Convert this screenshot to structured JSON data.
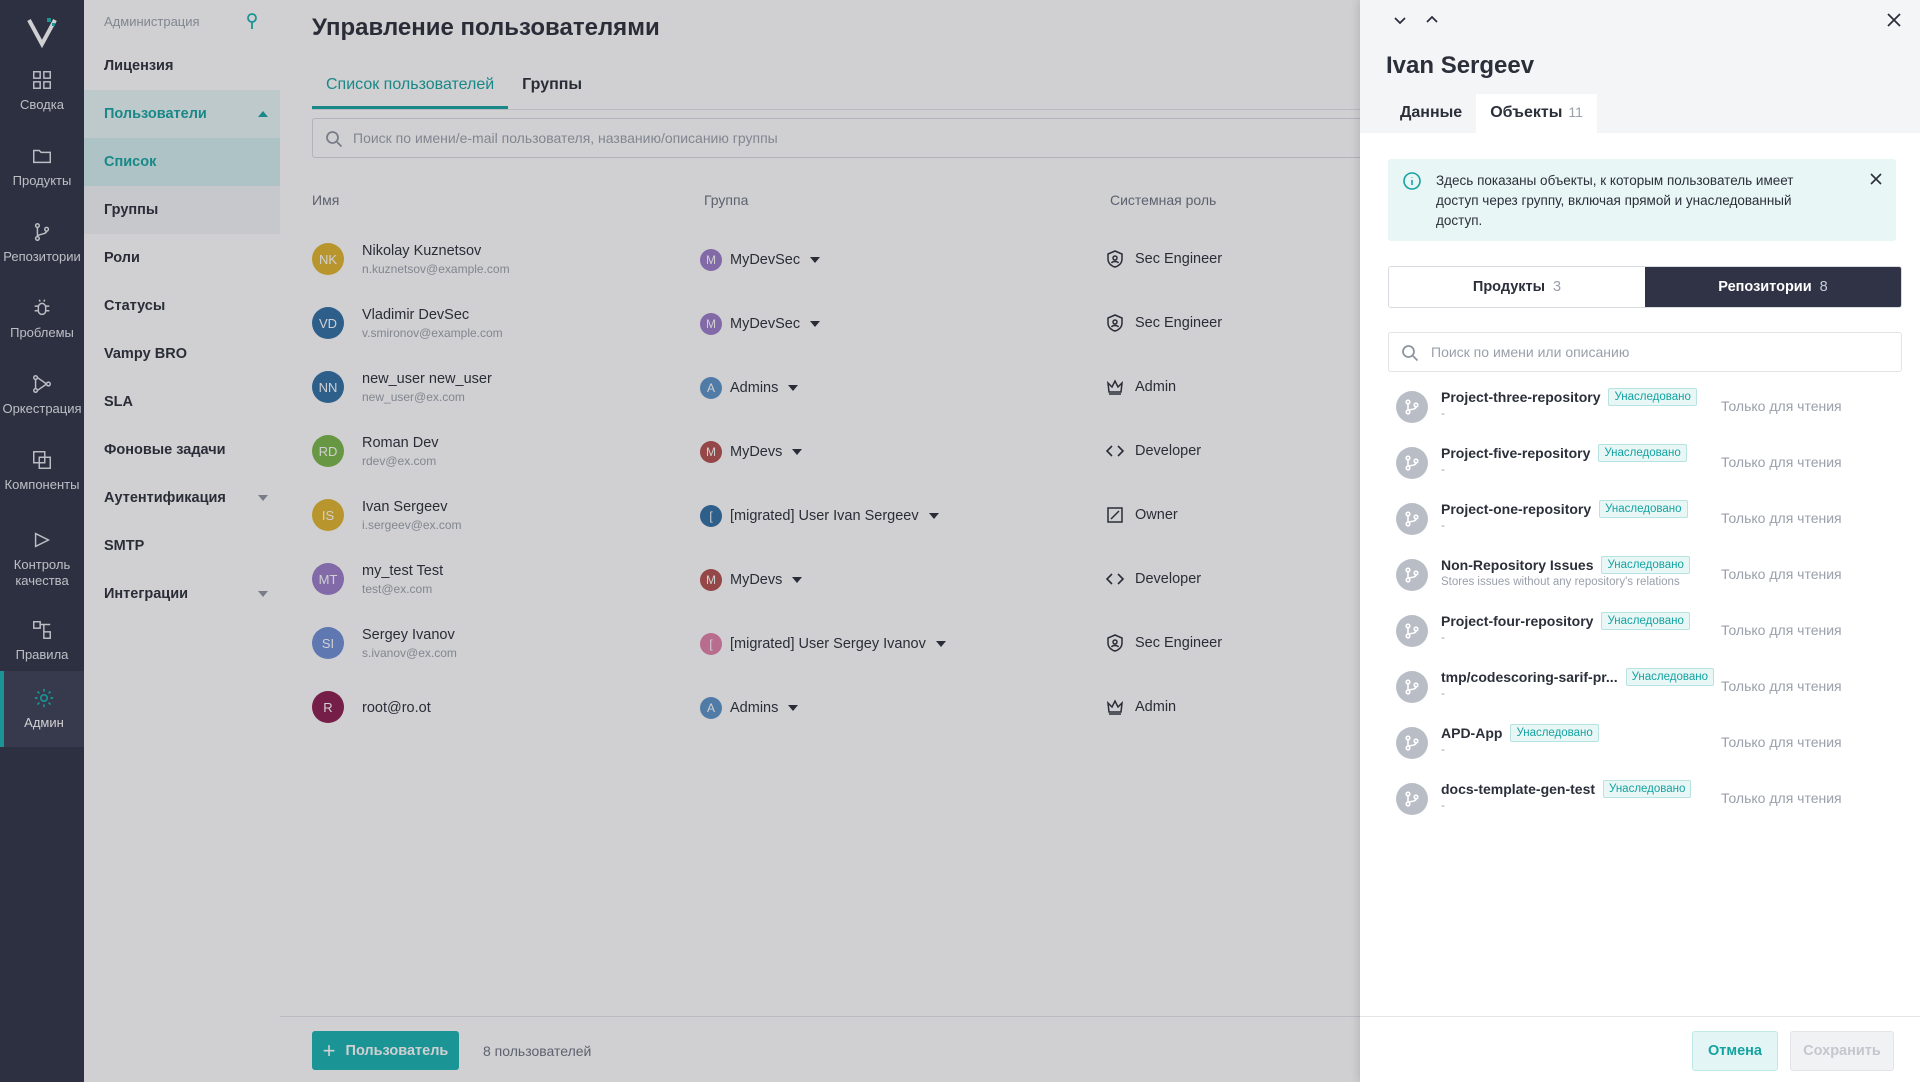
{
  "rail": {
    "items": [
      {
        "label": "Сводка",
        "icon": "dashboard-icon"
      },
      {
        "label": "Продукты",
        "icon": "folder-icon"
      },
      {
        "label": "Репозитории",
        "icon": "branch-icon"
      },
      {
        "label": "Проблемы",
        "icon": "bug-icon"
      },
      {
        "label": "Оркестрация",
        "icon": "orchestration-icon"
      },
      {
        "label": "Компоненты",
        "icon": "components-icon"
      },
      {
        "label": "Контроль качества",
        "icon": "play-icon"
      },
      {
        "label": "Правила",
        "icon": "rules-icon"
      },
      {
        "label": "Админ",
        "icon": "gear-icon"
      }
    ]
  },
  "sidebar": {
    "header": "Администрация",
    "items": [
      {
        "label": "Лицензия"
      },
      {
        "label": "Пользователи"
      },
      {
        "label": "Список"
      },
      {
        "label": "Группы"
      },
      {
        "label": "Роли"
      },
      {
        "label": "Статусы"
      },
      {
        "label": "Vampy BRO"
      },
      {
        "label": "SLA"
      },
      {
        "label": "Фоновые задачи"
      },
      {
        "label": "Аутентификация"
      },
      {
        "label": "SMTP"
      },
      {
        "label": "Интеграции"
      }
    ]
  },
  "main": {
    "title": "Управление пользователями",
    "tabs": [
      "Список пользователей",
      "Группы"
    ],
    "search_placeholder": "Поиск по имени/e-mail пользователя, названию/описанию группы",
    "columns": [
      "Имя",
      "Группа",
      "Системная роль"
    ],
    "users": [
      {
        "initials": "NK",
        "name": "Nikolay Kuznetsov",
        "email": "n.kuznetsov@example.com",
        "color": "#e1b52c",
        "group": "MyDevSec",
        "group_initial": "M",
        "group_color": "#9b7cc8",
        "role": "Sec Engineer",
        "role_icon": "shield-icon"
      },
      {
        "initials": "VD",
        "name": "Vladimir DevSec",
        "email": "v.smironov@example.com",
        "color": "#2f6fa3",
        "group": "MyDevSec",
        "group_initial": "M",
        "group_color": "#9b7cc8",
        "role": "Sec Engineer",
        "role_icon": "shield-icon"
      },
      {
        "initials": "NN",
        "name": "new_user new_user",
        "email": "new_user@ex.com",
        "color": "#2f6fa3",
        "group": "Admins",
        "group_initial": "A",
        "group_color": "#5c93c8",
        "role": "Admin",
        "role_icon": "crown-icon"
      },
      {
        "initials": "RD",
        "name": "Roman Dev",
        "email": "rdev@ex.com",
        "color": "#7ab648",
        "group": "MyDevs",
        "group_initial": "M",
        "group_color": "#b2504c",
        "role": "Developer",
        "role_icon": "code-icon"
      },
      {
        "initials": "IS",
        "name": "Ivan Sergeev",
        "email": "i.sergeev@ex.com",
        "color": "#e1b52c",
        "group": "[migrated] User Ivan Sergeev",
        "group_initial": "[",
        "group_color": "#2f6fa3",
        "role": "Owner",
        "role_icon": "edit-box-icon"
      },
      {
        "initials": "MT",
        "name": "my_test Test",
        "email": "test@ex.com",
        "color": "#9b7cc8",
        "group": "MyDevs",
        "group_initial": "M",
        "group_color": "#b2504c",
        "role": "Developer",
        "role_icon": "code-icon"
      },
      {
        "initials": "SI",
        "name": "Sergey Ivanov",
        "email": "s.ivanov@ex.com",
        "color": "#6f8fd6",
        "group": "[migrated] User Sergey Ivanov",
        "group_initial": "[",
        "group_color": "#e07fa8",
        "role": "Sec Engineer",
        "role_icon": "shield-icon"
      },
      {
        "initials": "R",
        "name": "root@ro.ot",
        "email": "",
        "color": "#8b1d4f",
        "group": "Admins",
        "group_initial": "A",
        "group_color": "#5c93c8",
        "role": "Admin",
        "role_icon": "crown-icon"
      }
    ],
    "add_button": "Пользователь",
    "count_text": "8 пользователей"
  },
  "drawer": {
    "title": "Ivan Sergeev",
    "tabs": [
      {
        "label": "Данные",
        "count": ""
      },
      {
        "label": "Объекты",
        "count": "11"
      }
    ],
    "info_text": "Здесь показаны объекты, к которым пользователь имеет доступ через группу, включая прямой и унаследованный доступ.",
    "segments": [
      {
        "label": "Продукты",
        "count": "3"
      },
      {
        "label": "Репозитории",
        "count": "8"
      }
    ],
    "search_placeholder": "Поиск по имени или описанию",
    "badge_label": "Унаследовано",
    "repos": [
      {
        "name": "Project-three-repository",
        "desc": "-",
        "access": "Только для чтения"
      },
      {
        "name": "Project-five-repository",
        "desc": "-",
        "access": "Только для чтения"
      },
      {
        "name": "Project-one-repository",
        "desc": "-",
        "access": "Только для чтения"
      },
      {
        "name": "Non-Repository Issues",
        "desc": "Stores issues without any repository's relations",
        "access": "Только для чтения"
      },
      {
        "name": "Project-four-repository",
        "desc": "-",
        "access": "Только для чтения"
      },
      {
        "name": "tmp/codescoring-sarif-pr...",
        "desc": "-",
        "access": "Только для чтения"
      },
      {
        "name": "APD-App",
        "desc": "-",
        "access": "Только для чтения"
      },
      {
        "name": "docs-template-gen-test",
        "desc": "-",
        "access": "Только для чтения"
      }
    ],
    "cancel_label": "Отмена",
    "save_label": "Сохранить"
  },
  "colors": {
    "accent": "#16b3b0",
    "rail": "#2f3345"
  }
}
